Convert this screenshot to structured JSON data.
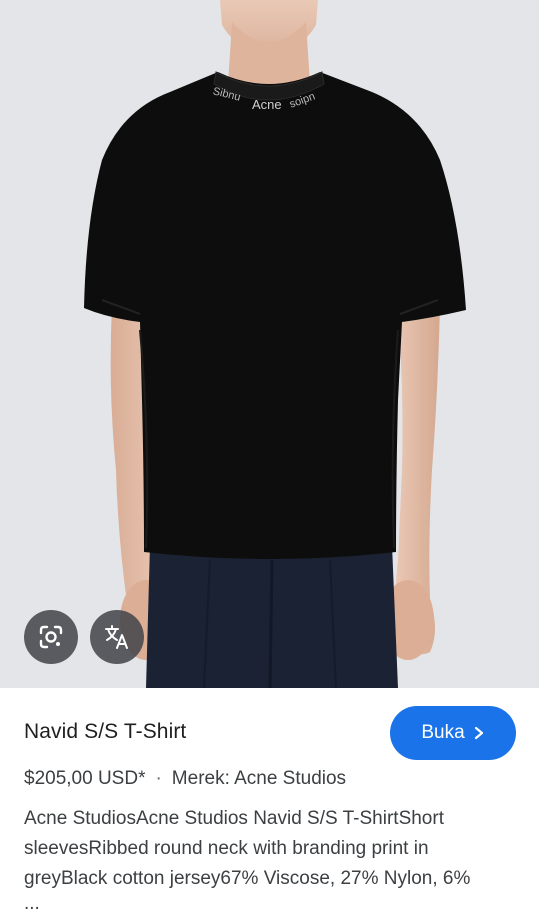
{
  "product": {
    "title": "Navid S/S T-Shirt",
    "price": "$205,00 USD*",
    "separator": "·",
    "brand": "Merek: Acne Studios",
    "description_lines": [
      "Acne StudiosAcne Studios Navid S/S T-ShirtShort",
      "sleevesRibbed round neck with branding print in",
      "greyBlack cotton jersey67% Viscose, 27% Nylon, 6%"
    ],
    "ellipsis": "..."
  },
  "actions": {
    "open_label": "Buka",
    "open_icon": "chevron-right-icon",
    "lens_icon": "google-lens-icon",
    "translate_icon": "translate-icon"
  },
  "image": {
    "collar_print": "Acne Studios",
    "background_color": "#e3e5e8",
    "shirt_color": "#0d0d0d",
    "pants_color": "#1b2233"
  },
  "colors": {
    "accent": "#1a73e8"
  }
}
